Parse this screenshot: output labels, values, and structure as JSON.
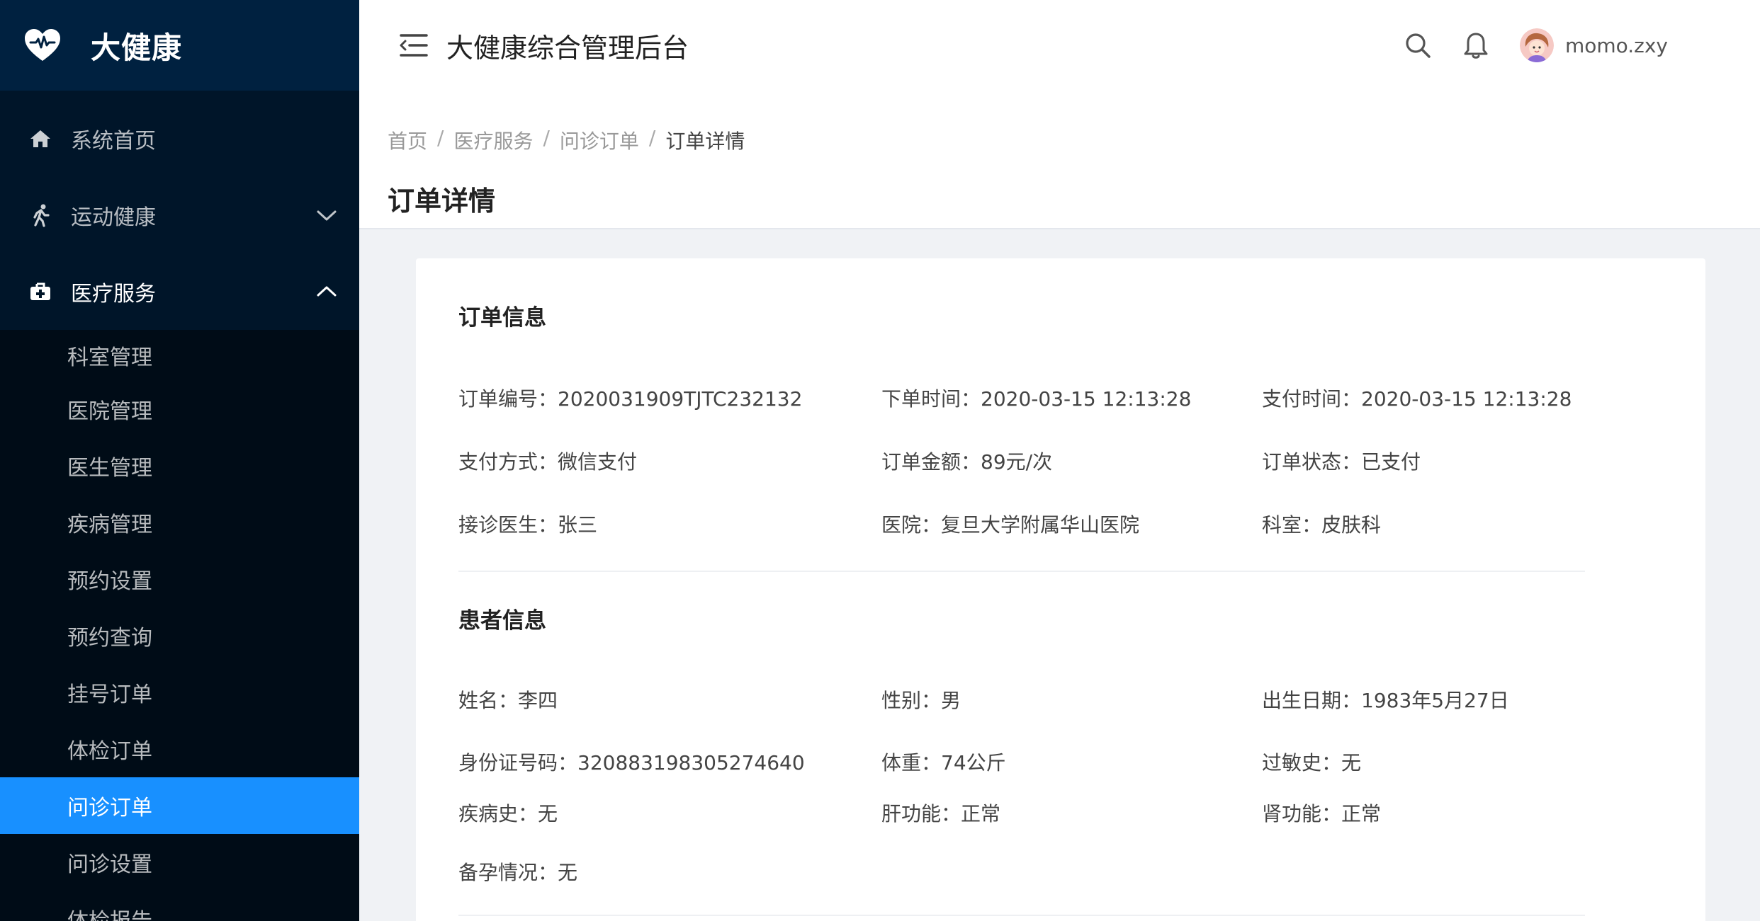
{
  "brand": {
    "name": "大健康"
  },
  "sidebar": {
    "items": [
      {
        "label": "系统首页",
        "icon": "home-icon"
      },
      {
        "label": "运动健康",
        "icon": "running-icon",
        "expandable": true,
        "expanded": false
      },
      {
        "label": "医疗服务",
        "icon": "medical-kit-icon",
        "expandable": true,
        "expanded": true
      }
    ],
    "submenu": [
      {
        "label": "科室管理"
      },
      {
        "label": "医院管理"
      },
      {
        "label": "医生管理"
      },
      {
        "label": "疾病管理"
      },
      {
        "label": "预约设置"
      },
      {
        "label": "预约查询"
      },
      {
        "label": "挂号订单"
      },
      {
        "label": "体检订单"
      },
      {
        "label": "问诊订单",
        "active": true
      },
      {
        "label": "问诊设置"
      },
      {
        "label": "体检报告"
      }
    ]
  },
  "header": {
    "title": "大健康综合管理后台",
    "username": "momo.zxy"
  },
  "breadcrumb": {
    "items": [
      "首页",
      "医疗服务",
      "问诊订单"
    ],
    "current": "订单详情",
    "separator": "/"
  },
  "page": {
    "title": "订单详情"
  },
  "order_info": {
    "title": "订单信息",
    "fields": [
      {
        "label": "订单编号：",
        "value": "2020031909TJTC232132"
      },
      {
        "label": "下单时间：",
        "value": "2020-03-15 12:13:28"
      },
      {
        "label": "支付时间：",
        "value": "2020-03-15 12:13:28"
      },
      {
        "label": "支付方式：",
        "value": "微信支付"
      },
      {
        "label": "订单金额：",
        "value": "89元/次"
      },
      {
        "label": "订单状态：",
        "value": "已支付"
      },
      {
        "label": "接诊医生：",
        "value": "张三"
      },
      {
        "label": "医院：",
        "value": "复旦大学附属华山医院"
      },
      {
        "label": "科室：",
        "value": "皮肤科"
      }
    ]
  },
  "patient_info": {
    "title": "患者信息",
    "fields": [
      {
        "label": "姓名：",
        "value": "李四"
      },
      {
        "label": "性别：",
        "value": "男"
      },
      {
        "label": "出生日期：",
        "value": "1983年5月27日"
      },
      {
        "label": "身份证号码：",
        "value": "320883198305274640"
      },
      {
        "label": "体重：",
        "value": "74公斤"
      },
      {
        "label": "过敏史：",
        "value": "无"
      },
      {
        "label": "疾病史：",
        "value": "无"
      },
      {
        "label": "肝功能：",
        "value": "正常"
      },
      {
        "label": "肾功能：",
        "value": "正常"
      },
      {
        "label": "备孕情况：",
        "value": "无"
      }
    ]
  },
  "colors": {
    "sidebar_bg": "#001529",
    "brand_bg": "#002140",
    "submenu_bg": "#000c17",
    "active": "#1890ff"
  }
}
